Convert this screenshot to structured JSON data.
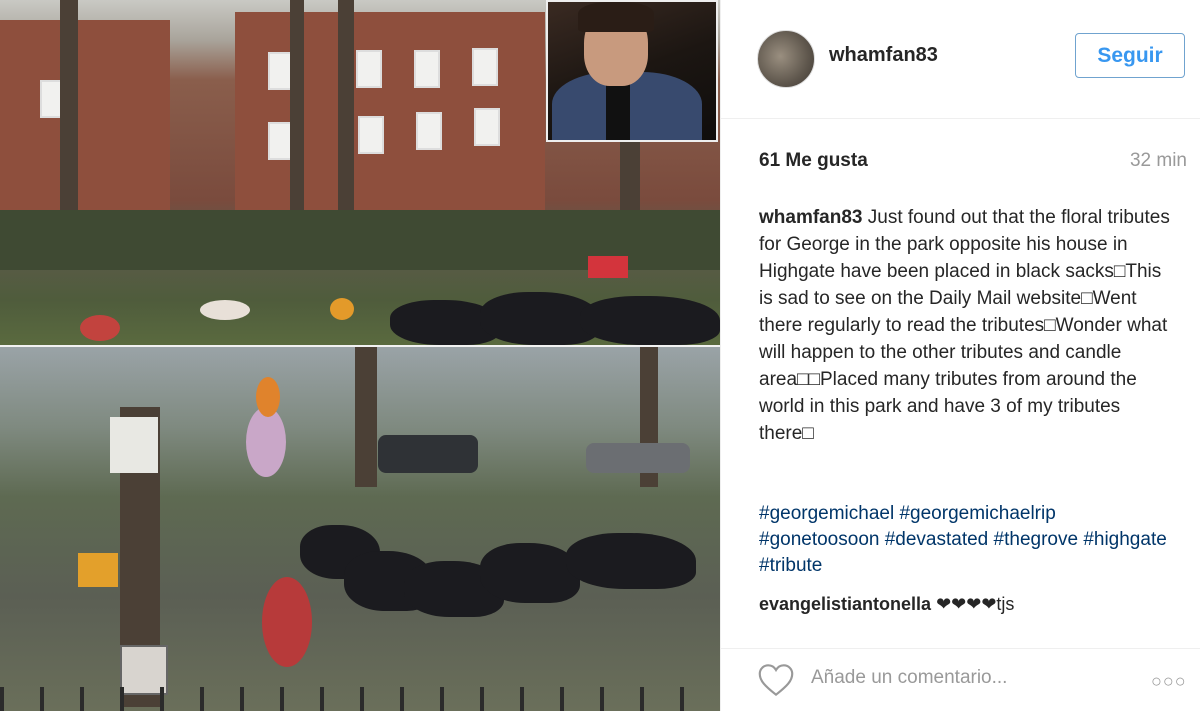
{
  "post": {
    "username": "whamfan83",
    "follow_label": "Seguir",
    "likes": "61 Me gusta",
    "time": "32 min",
    "caption": "Just found out that the floral tributes for George in the park opposite his house in Highgate have been placed in black sacks□This is sad to see on the Daily Mail website□Went there regularly to read the tributes□Wonder what will happen to the other tributes and candle area□□Placed many tributes from around the world in this park and have 3 of my tributes there□",
    "hashtags": "#georgemichael #georgemichaelrip #gonetoosoon #devastated #thegrove #highgate #tribute",
    "comment_user": "evangelistiantonella",
    "comment_text": "❤❤❤❤tjs",
    "add_comment_placeholder": "Añade un comentario...",
    "more_label": "○○○"
  },
  "icons": {
    "like": "heart-outline-icon",
    "more": "ellipsis-icon"
  },
  "colors": {
    "follow_text": "#3897f0",
    "hashtag": "#003569",
    "muted": "#999999"
  }
}
